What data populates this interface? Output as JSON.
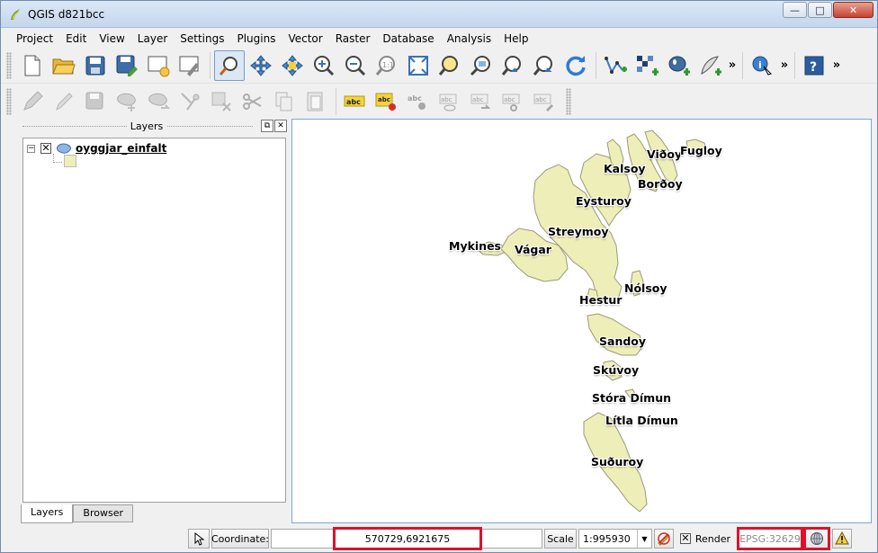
{
  "window": {
    "title": "QGIS d821bcc",
    "minimize": "—",
    "maximize": "□",
    "close": "✕"
  },
  "menu": [
    "Project",
    "Edit",
    "View",
    "Layer",
    "Settings",
    "Plugins",
    "Vector",
    "Raster",
    "Database",
    "Analysis",
    "Help"
  ],
  "toolbar1": {
    "groups": [
      [
        "new-project-icon",
        "open-project-icon",
        "save-project-icon",
        "save-as-icon",
        "new-print-composer-icon",
        "composer-manager-icon"
      ],
      [
        "touch-zoom-icon",
        "pan-map-icon",
        "pan-to-selection-icon",
        "zoom-in-icon",
        "zoom-out-icon",
        "zoom-actual-size-icon",
        "zoom-full-icon",
        "zoom-to-selection-icon",
        "zoom-to-layer-icon",
        "zoom-last-icon",
        "zoom-next-icon",
        "refresh-icon"
      ],
      [
        "add-vector-layer-icon",
        "add-raster-layer-icon",
        "add-postgis-layer-icon",
        "add-spatialite-layer-icon"
      ],
      [
        "identify-icon"
      ],
      [
        "help-icon"
      ]
    ],
    "more": "»"
  },
  "toolbar2": {
    "icons": [
      "toggle-editing-icon",
      "current-edits-icon",
      "save-edits-icon",
      "add-feature-icon",
      "move-feature-icon",
      "node-tool-icon",
      "delete-selected-icon",
      "cut-features-icon",
      "copy-features-icon",
      "paste-features-icon",
      "label-layer-icon",
      "layer-labeling-icon",
      "pin-labels-icon",
      "show-hide-labels-icon",
      "move-label-icon",
      "rotate-label-icon",
      "change-label-icon"
    ],
    "label_text": "abc"
  },
  "layers_panel": {
    "title": "Layers",
    "float": "⧉",
    "close": "✕",
    "layer": {
      "name": "oyggjar_einfalt",
      "checked": "✕",
      "expander": "−"
    },
    "tabs": [
      "Layers",
      "Browser"
    ]
  },
  "map": {
    "fill_color": "#eeeeb8",
    "stroke_color": "#9a9a7a",
    "labels": [
      "Viðoy",
      "Fugloy",
      "Kalsoy",
      "Borðoy",
      "Eysturoy",
      "Streymoy",
      "Mykines",
      "Vágar",
      "Nólsoy",
      "Hestur",
      "Sandoy",
      "Skúvoy",
      "Stóra Dímun",
      "Lítla Dímun",
      "Suðuroy"
    ]
  },
  "statusbar": {
    "coordinate_label": "Coordinate:",
    "coordinate_value": "570729,6921675",
    "scale_label": "Scale",
    "scale_value": "1:995930",
    "render_label": "Render",
    "render_checked": "✕",
    "crs": "EPSG:32629",
    "highlight_color": "#e0102b"
  }
}
